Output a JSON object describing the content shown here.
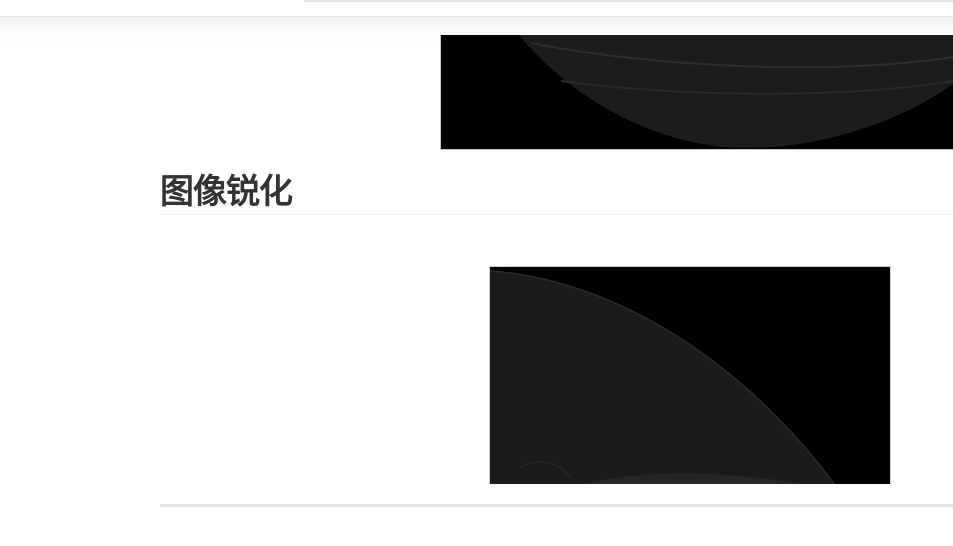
{
  "section": {
    "title": "图像锐化"
  },
  "figures": [
    {
      "name": "image-ct-top",
      "description_icon": "image-icon"
    },
    {
      "name": "image-ct-sharpened",
      "description_icon": "image-icon"
    }
  ],
  "colors": {
    "text": "#333333",
    "image_background": "#000000",
    "image_tissue": "#1b1b1b",
    "divider": "#eeeeee"
  }
}
